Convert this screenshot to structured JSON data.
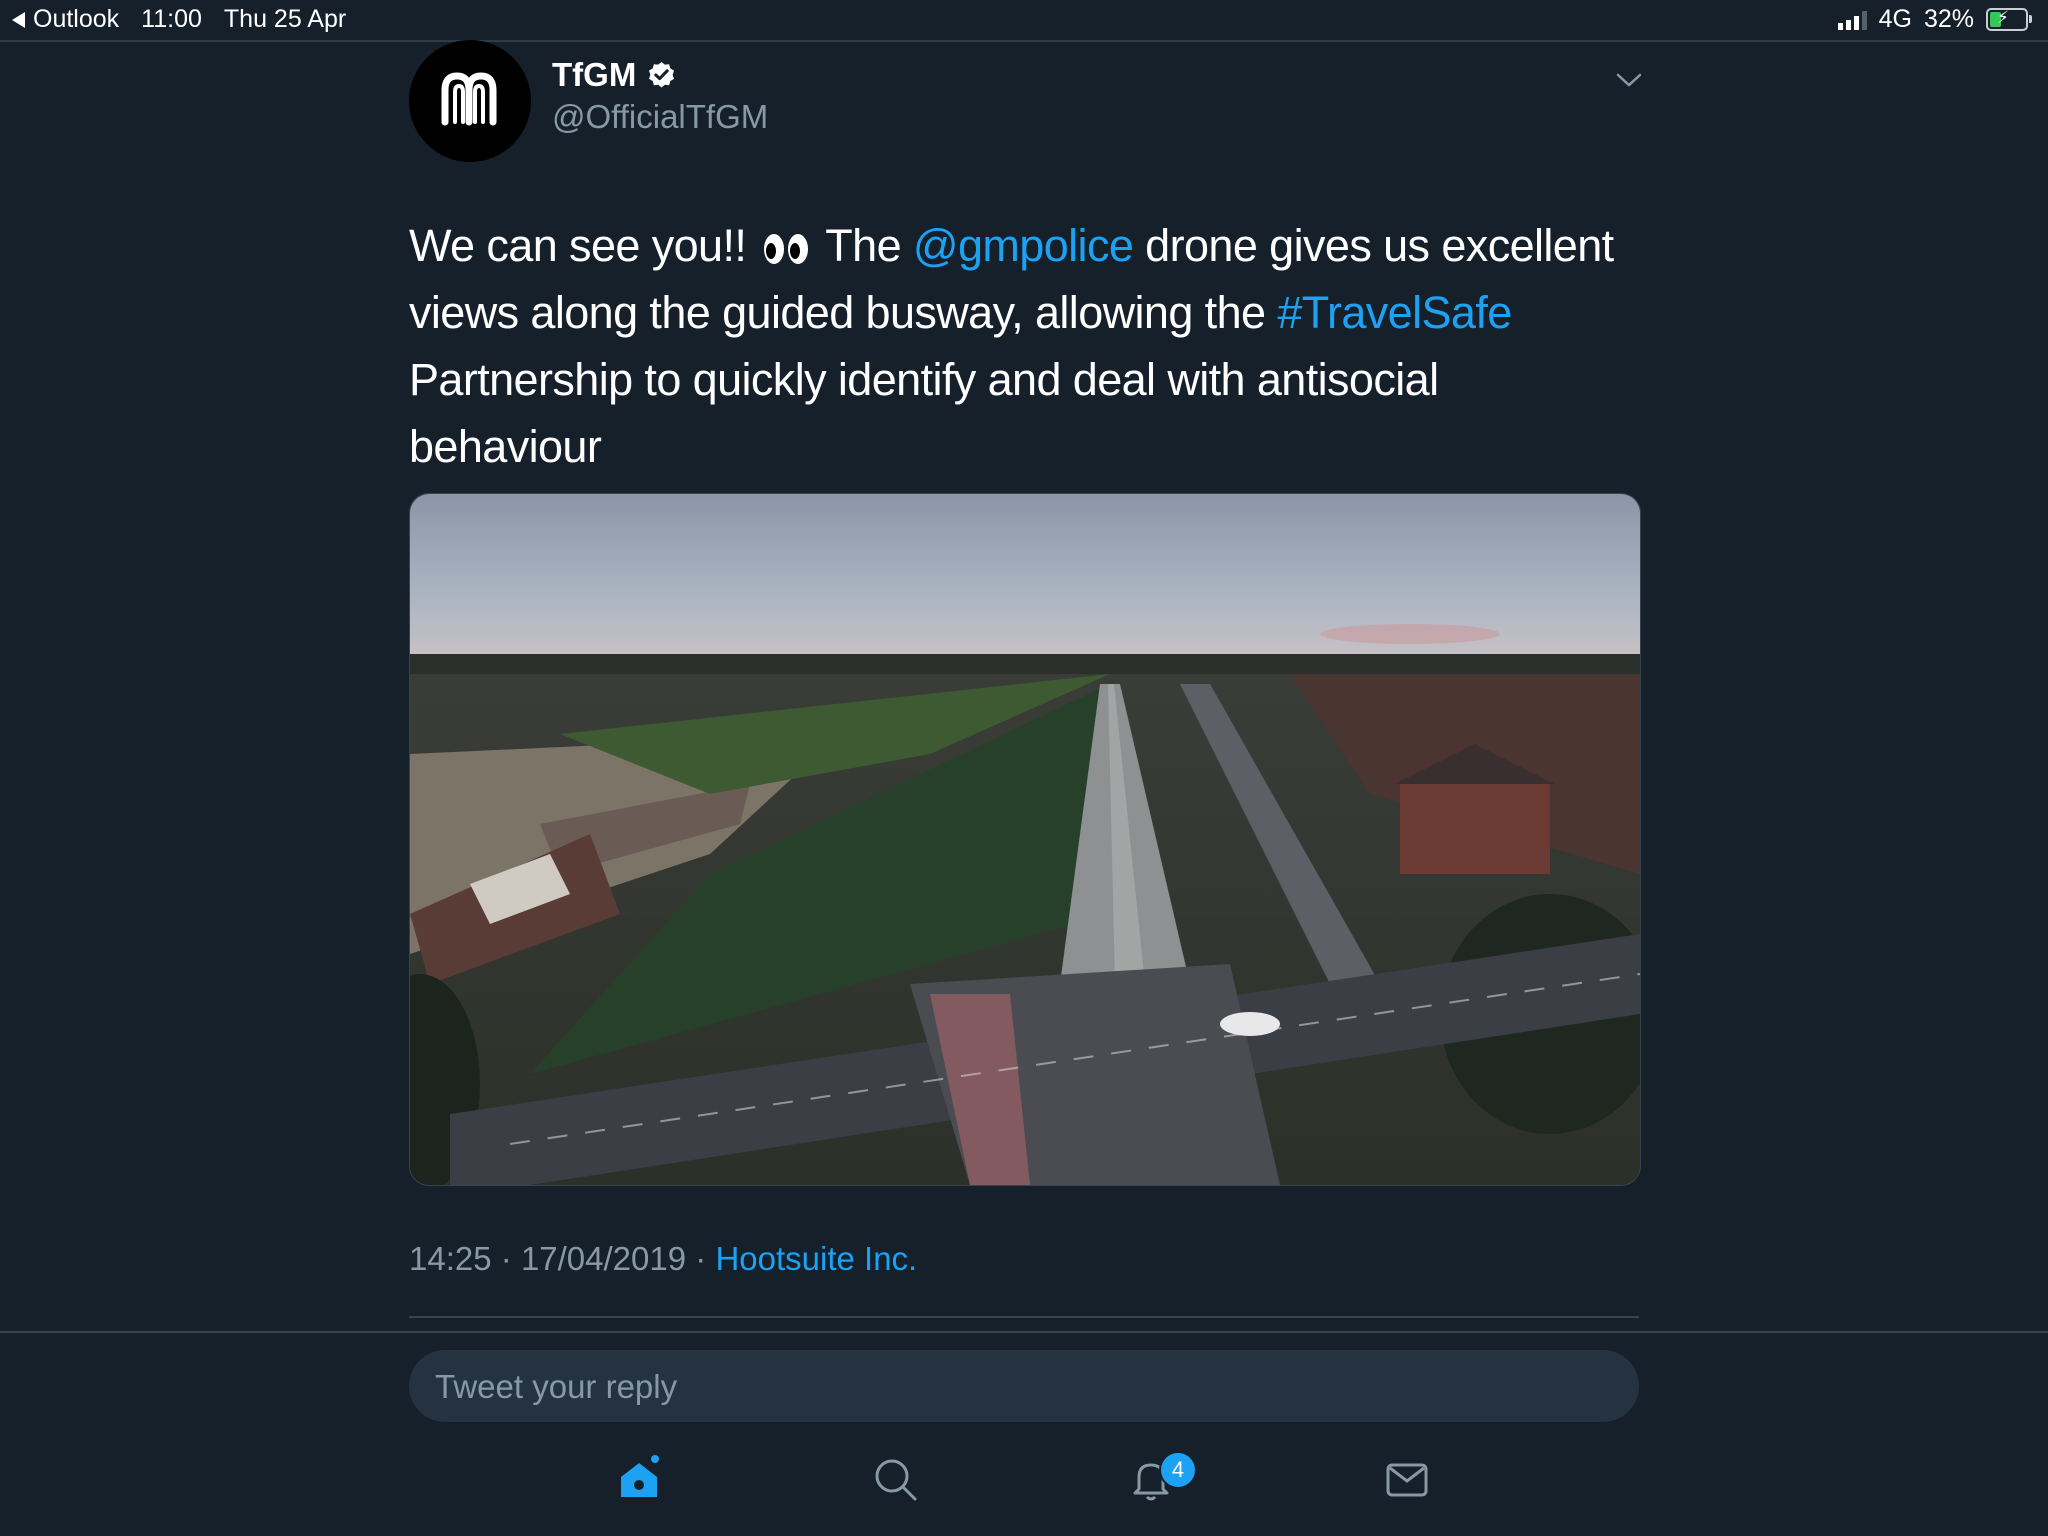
{
  "status_bar": {
    "back_app": "Outlook",
    "time": "11:00",
    "date": "Thu 25 Apr",
    "network": "4G",
    "battery": "32%"
  },
  "tweet": {
    "author_name": "TfGM",
    "handle": "@OfficialTfGM",
    "text_parts": {
      "p1": "We can see you!! ",
      "p2": " The ",
      "mention": "@gmpolice",
      "p3": " drone gives us excellent views along the guided busway, allowing the ",
      "hashtag": "#TravelSafe",
      "p4": " Partnership to quickly identify and deal with antisocial behaviour"
    },
    "time": "14:25",
    "date": "17/04/2019",
    "separator": "·",
    "source": "Hootsuite Inc."
  },
  "reply": {
    "placeholder": "Tweet your reply"
  },
  "tab_bar": {
    "notifications_badge": "4"
  },
  "icons": [
    "back-icon",
    "signal-icon",
    "battery-icon",
    "verified-icon",
    "chevron-down-icon",
    "home-icon",
    "search-icon",
    "bell-icon",
    "mail-icon"
  ],
  "colors": {
    "background": "#15202b",
    "accent": "#1da1f2",
    "secondary_text": "#8899a6"
  }
}
